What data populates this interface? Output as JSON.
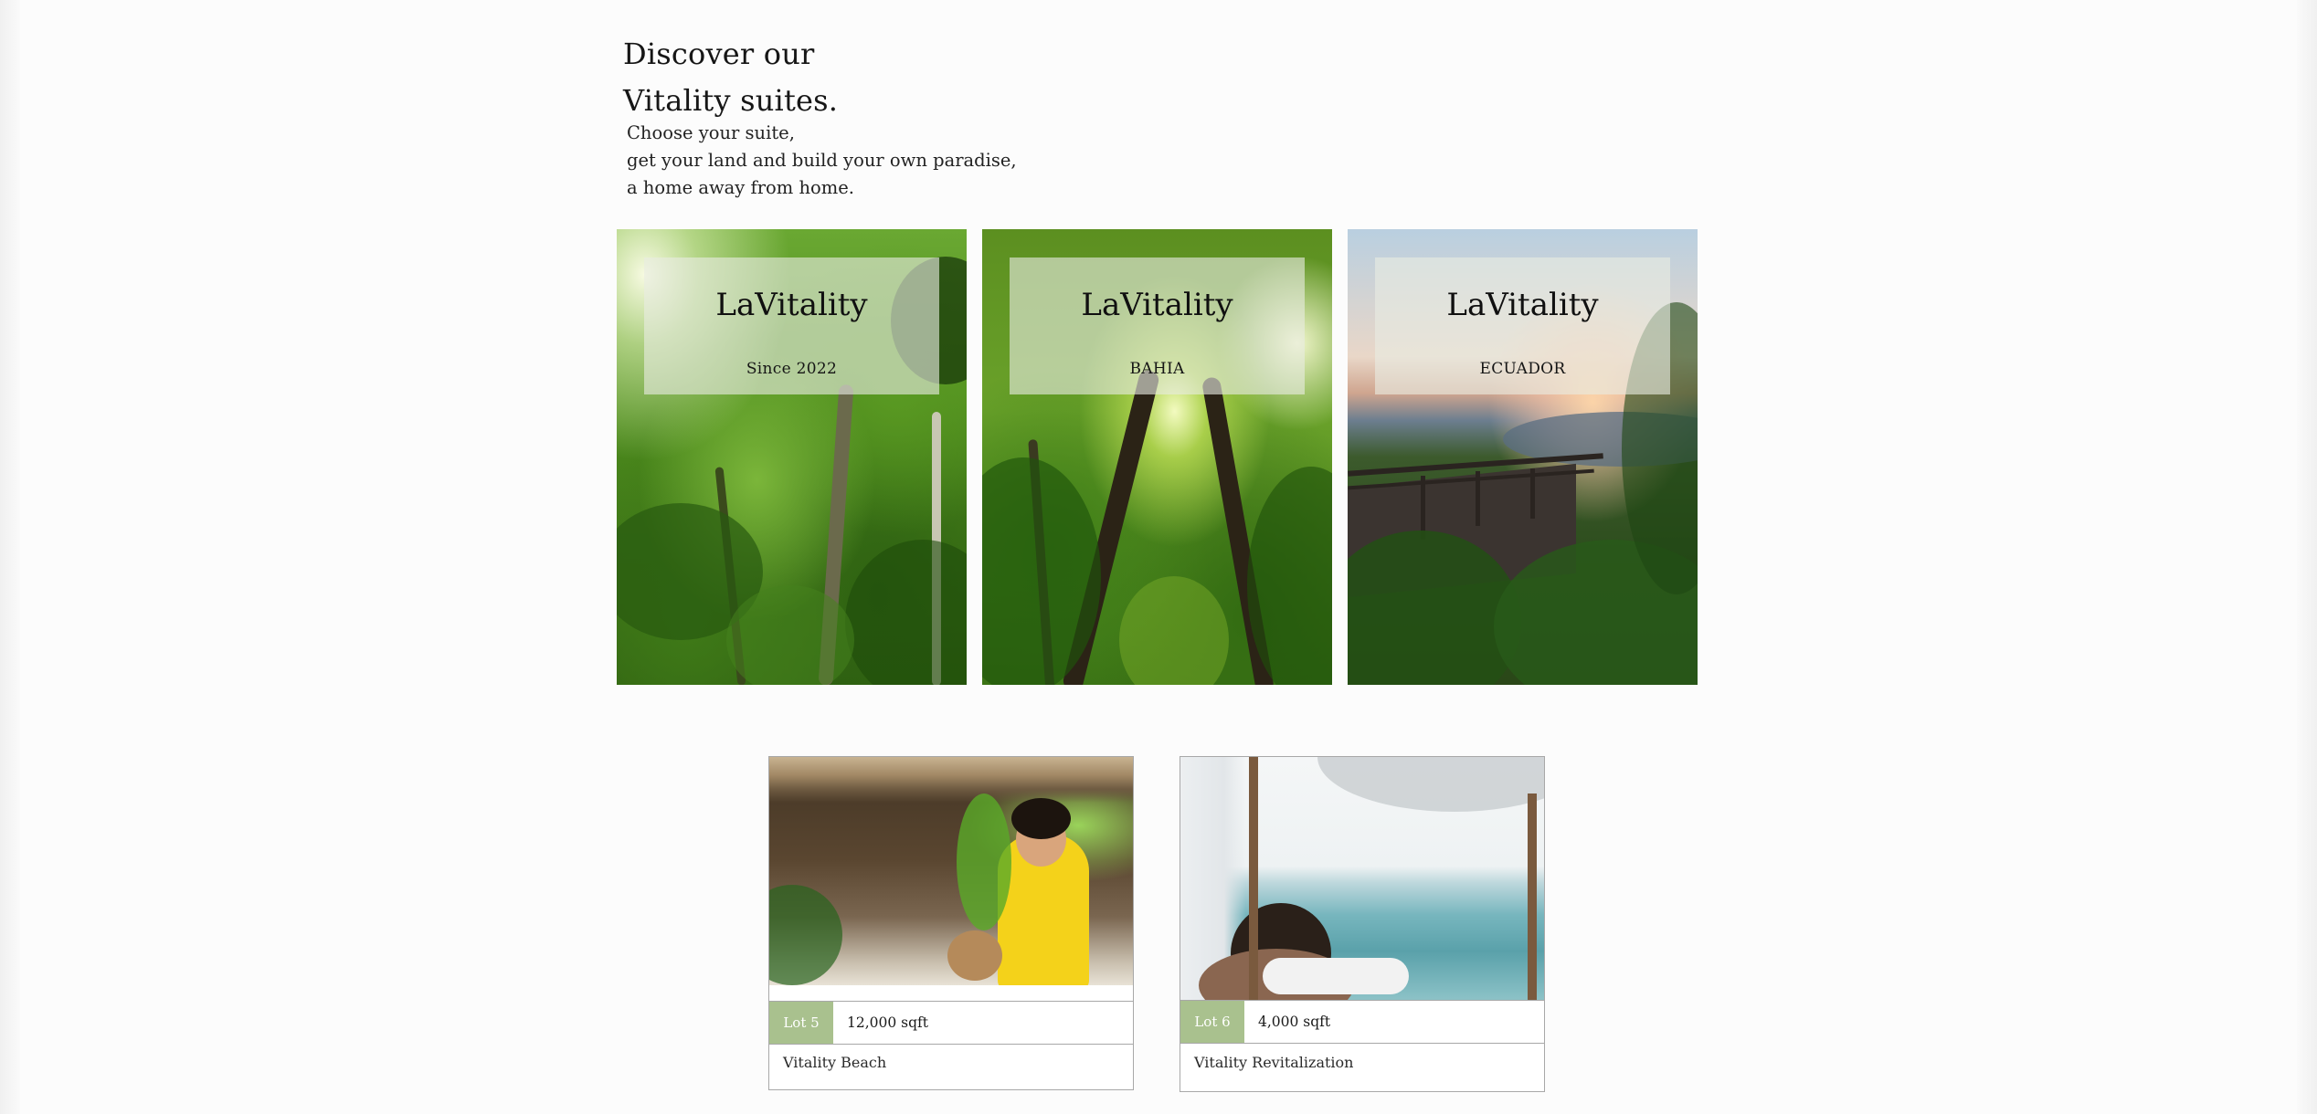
{
  "intro": {
    "heading_line1": "Discover our",
    "heading_line2": "Vitality suites.",
    "subtitle_line1": "Choose your suite,",
    "subtitle_line2": "get your land and build your own paradise,",
    "subtitle_line3": "a home away from home."
  },
  "locations": [
    {
      "title": "LaVitality",
      "subtitle": "Since 2022",
      "image": "rainforest-canopy"
    },
    {
      "title": "LaVitality",
      "subtitle": "BAHIA",
      "image": "sunlit-jungle-path"
    },
    {
      "title": "LaVitality",
      "subtitle": "ECUADOR",
      "image": "jungle-boardwalk-overlook"
    }
  ],
  "lots": [
    {
      "badge": "Lot 5",
      "size": "12,000 sqft",
      "name": "Vitality Beach",
      "image": "woman-with-coconut-tropical-hut"
    },
    {
      "badge": "Lot 6",
      "size": "4,000 sqft",
      "name": "Vitality Revitalization",
      "image": "spa-massage-ocean-view"
    }
  ],
  "colors": {
    "background": "#fcfcfc",
    "lot_badge": "#a9c18e",
    "overlay": "rgba(232,236,226,0.62)",
    "border": "#a8a8a8"
  }
}
